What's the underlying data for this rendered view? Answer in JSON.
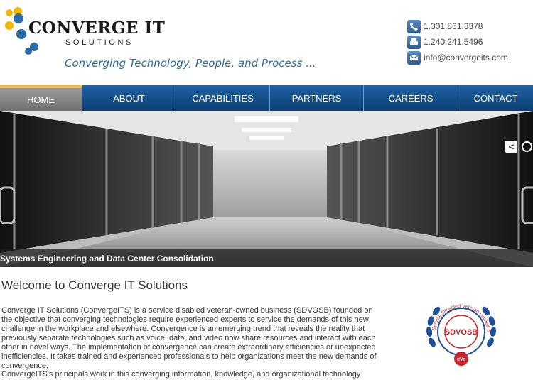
{
  "brand": {
    "name": "CONVERGE IT",
    "sub": "SOLUTIONS",
    "tagline_part1": "Converging Technology, People, and Process ...",
    "tagline_part2": ""
  },
  "contact": {
    "phone": "1.301.861.3378",
    "fax": "1.240.241.5496",
    "email": "info@convergeits.com"
  },
  "nav": {
    "items": [
      "HOME",
      "ABOUT",
      "CAPABILITIES",
      "PARTNERS",
      "CAREERS",
      "CONTACT"
    ],
    "active": "HOME"
  },
  "hero": {
    "caption": "Systems Engineering and Data Center Consolidation",
    "next_glyph": "<"
  },
  "main": {
    "title": "Welcome to Converge IT Solutions",
    "para1": "Converge IT Solutions (ConvergeITS) is a service disabled veteran-owned business (SDVOSB) founded on the objective that converging technologies require experienced experts to service the demands of this new challenge in the workplace and elsewhere. Convergence is an emerging trend that reveals the reality that previously separate technologies such as voice, data, and video now share resources and interact with each other in novel ways. The implementation of convergence can create extraordinary efficiencies or unexpected inefficiencies. It takes trained and experienced professionals to help organizations meet the new demands of convergence.",
    "para2": "ConvergeITS's principals work in this converging information, knowledge, and organizational technology domain"
  },
  "seal": {
    "center": "SDVOSB",
    "ring": "Service Disabled Veteran Owned Small Business",
    "bottom": "cVe"
  },
  "colors": {
    "nav_blue": "#1e63a3",
    "accent_gold": "#f0b53a",
    "tag_blue": "#2f6b9a",
    "tag_gold": "#c9a22e",
    "seal_red": "#c8262c",
    "seal_blue": "#1d4f9a"
  },
  "icons": [
    "phone-icon",
    "fax-icon",
    "email-icon"
  ]
}
